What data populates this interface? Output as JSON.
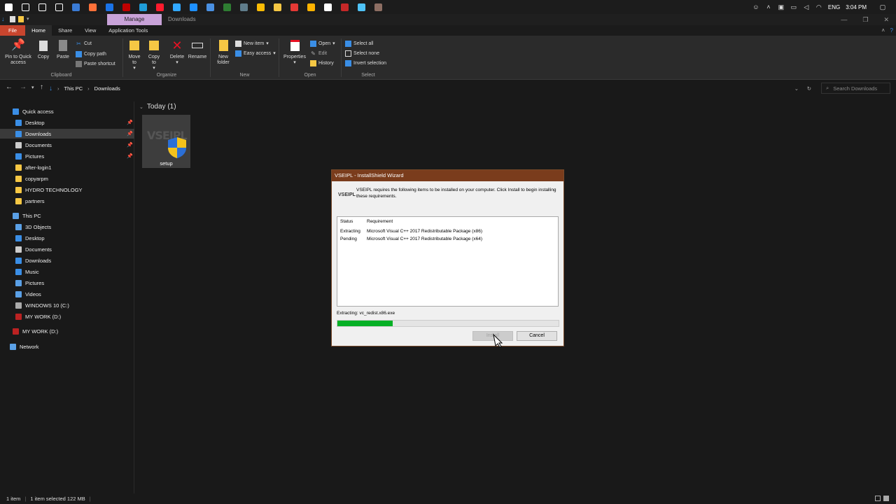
{
  "taskbar": {
    "apps": [
      {
        "icon": "windows-logo-icon",
        "color": "#ffffff"
      },
      {
        "icon": "search-icon",
        "color": "#ffffff"
      },
      {
        "icon": "cortana-icon",
        "color": "#ffffff"
      },
      {
        "icon": "task-view-icon",
        "color": "#ffffff"
      },
      {
        "icon": "store-icon",
        "color": "#3a7bd5"
      },
      {
        "icon": "firefox-icon",
        "color": "#ff7139"
      },
      {
        "icon": "mail-icon",
        "color": "#1a73e8"
      },
      {
        "icon": "filezilla-icon",
        "color": "#bf0000"
      },
      {
        "icon": "edge-icon",
        "color": "#1f9cd8"
      },
      {
        "icon": "opera-icon",
        "color": "#ff1b2d"
      },
      {
        "icon": "photoshop-icon",
        "color": "#31a8ff"
      },
      {
        "icon": "app-icon",
        "color": "#1e90ff"
      },
      {
        "icon": "app-icon",
        "color": "#4a90e2"
      },
      {
        "icon": "app-icon",
        "color": "#2e7d32"
      },
      {
        "icon": "app-icon",
        "color": "#607d8b"
      },
      {
        "icon": "chrome-icon",
        "color": "#fbbc05"
      },
      {
        "icon": "file-explorer-icon",
        "color": "#f6c744"
      },
      {
        "icon": "app-icon",
        "color": "#e53935"
      },
      {
        "icon": "app-icon",
        "color": "#ffb300"
      },
      {
        "icon": "app-icon",
        "color": "#ffffff"
      },
      {
        "icon": "app-icon",
        "color": "#c62828"
      },
      {
        "icon": "app-icon",
        "color": "#4fc3f7"
      },
      {
        "icon": "app-icon",
        "color": "#8d6e63"
      }
    ],
    "tray": {
      "language": "ENG",
      "time": "3:04 PM"
    }
  },
  "window": {
    "contextual_tab": "Manage",
    "title": "Downloads"
  },
  "ribbon_tabs": [
    "File",
    "Home",
    "Share",
    "View",
    "Application Tools"
  ],
  "ribbon": {
    "clipboard": {
      "label": "Clipboard",
      "pin": "Pin to Quick access",
      "copy": "Copy",
      "paste": "Paste",
      "cut": "Cut",
      "copy_path": "Copy path",
      "paste_shortcut": "Paste shortcut"
    },
    "organize": {
      "label": "Organize",
      "move_to": "Move to",
      "copy_to": "Copy to",
      "delete": "Delete",
      "rename": "Rename"
    },
    "new": {
      "label": "New",
      "new_folder": "New folder",
      "new_item": "New item",
      "easy_access": "Easy access"
    },
    "open": {
      "label": "Open",
      "properties": "Properties",
      "open": "Open",
      "edit": "Edit",
      "history": "History"
    },
    "select": {
      "label": "Select",
      "select_all": "Select all",
      "select_none": "Select none",
      "invert": "Invert selection"
    }
  },
  "address": {
    "crumbs": [
      "This PC",
      "Downloads"
    ],
    "search_placeholder": "Search Downloads"
  },
  "nav": {
    "quick_access": "Quick access",
    "quick_items": [
      "Desktop",
      "Downloads",
      "Documents",
      "Pictures",
      "after-login1",
      "copyarpm",
      "HYDRO TECHNOLOGY",
      "partners"
    ],
    "this_pc": "This PC",
    "pc_items": [
      "3D Objects",
      "Desktop",
      "Documents",
      "Downloads",
      "Music",
      "Pictures",
      "Videos",
      "WINDOWS 10 (C:)",
      "MY WORK (D:)"
    ],
    "drive": "MY WORK (D:)",
    "network": "Network"
  },
  "content": {
    "group": "Today (1)",
    "file": {
      "name": "setup",
      "thumb_text": "VSEIPL"
    }
  },
  "status": {
    "count": "1 item",
    "selected": "1 item selected  122 MB"
  },
  "dialog": {
    "title": "VSEIPL - InstallShield Wizard",
    "logo": "VSEIPL",
    "message": "VSEIPL  requires the following items to be installed on your computer. Click Install to begin installing these requirements.",
    "col_status": "Status",
    "col_requirement": "Requirement",
    "rows": [
      {
        "status": "Extracting",
        "requirement": "Microsoft Visual C++ 2017 Redistributable Package (x86)"
      },
      {
        "status": "Pending",
        "requirement": "Microsoft Visual C++ 2017 Redistributable Package (x64)"
      }
    ],
    "extracting": "Extracting: vc_redist.x86.exe",
    "progress": 0.25,
    "install": "Install",
    "cancel": "Cancel"
  }
}
